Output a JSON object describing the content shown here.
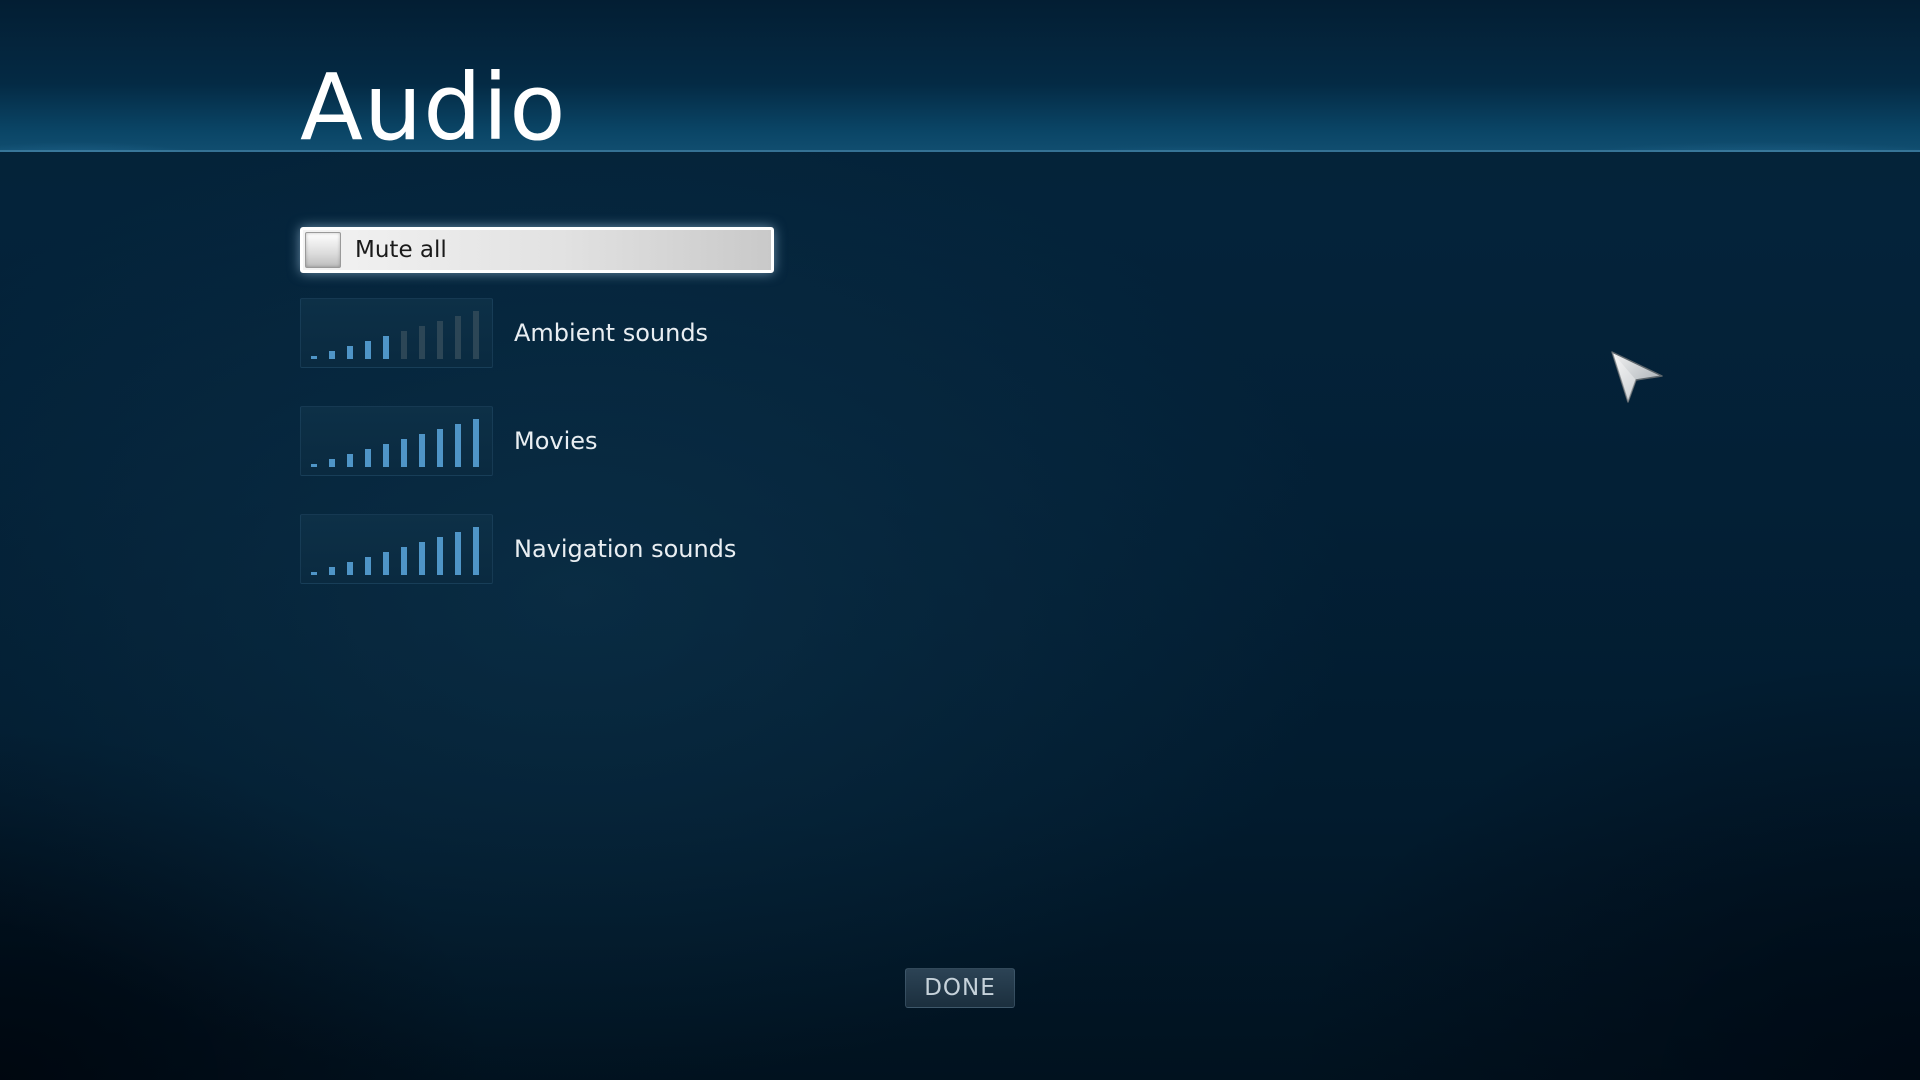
{
  "page": {
    "title": "Audio"
  },
  "mute": {
    "label": "Mute all",
    "checked": false
  },
  "sliders": [
    {
      "label": "Ambient sounds",
      "level": 5,
      "max_level": 10
    },
    {
      "label": "Movies",
      "level": 10,
      "max_level": 10
    },
    {
      "label": "Navigation sounds",
      "level": 10,
      "max_level": 10
    }
  ],
  "footer": {
    "done_label": "DONE"
  },
  "icons": {
    "cursor": "mouse-pointer-icon",
    "checkbox": "checkbox-icon",
    "volume": "volume-bars-icon"
  },
  "colors": {
    "accent": "#4f95c7",
    "bar_inactive": "#2c4656",
    "background": "#021a2c"
  }
}
